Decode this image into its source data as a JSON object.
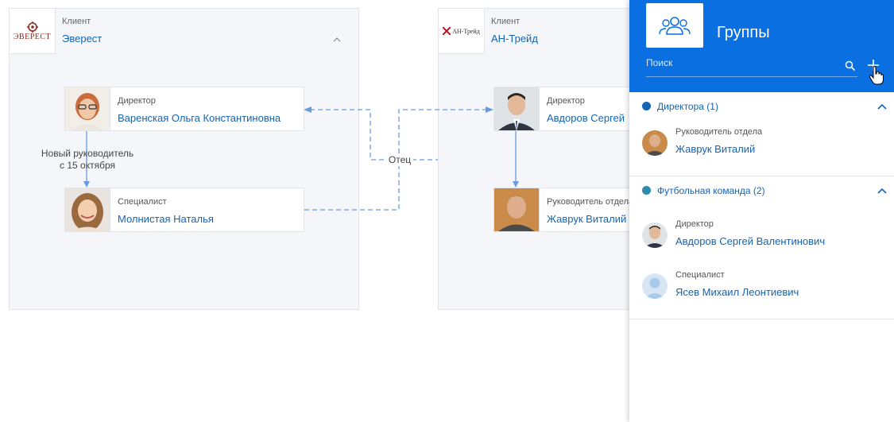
{
  "clients": {
    "everest": {
      "caption": "Клиент",
      "name": "Эверест",
      "logo_text": "ЭВЕРЕСТ",
      "logo_color": "#8a2a1e"
    },
    "an_trade": {
      "caption": "Клиент",
      "name": "АН-Трейд",
      "logo_text": "АН-Трейд",
      "logo_color": "#b3161c"
    }
  },
  "people": {
    "varenskaya": {
      "role": "Директор",
      "name": "Варенская Ольга Константиновна"
    },
    "molnistaya": {
      "role": "Специалист",
      "name": "Молнистая Наталья"
    },
    "avdorov": {
      "role": "Директор",
      "name": "Авдоров Сергей"
    },
    "zhavruk": {
      "role": "Руководитель отдела",
      "name": "Жаврук Виталий"
    }
  },
  "connector_labels": {
    "new_head_line1": "Новый руководитель",
    "new_head_line2": "с 15 октября",
    "father": "Отец"
  },
  "drawer": {
    "title": "Группы",
    "search_placeholder": "Поиск",
    "icons": {
      "header": "people-group-icon",
      "search": "search-icon",
      "add": "plus-icon",
      "cursor": "hand-cursor-icon"
    },
    "groups": [
      {
        "title": "Директора (1)",
        "dot_color": "#1464b4",
        "title_color": "#1464b4",
        "members": [
          {
            "role": "Руководитель отдела",
            "name": "Жаврук Виталий"
          }
        ]
      },
      {
        "title": "Футбольная команда (2)",
        "dot_color": "#2a8ab0",
        "title_color": "#1464b4",
        "members": [
          {
            "role": "Директор",
            "name": "Авдоров Сергей Валентинович"
          },
          {
            "role": "Специалист",
            "name": "Ясев Михаил Леонтиевич"
          }
        ]
      }
    ]
  },
  "colors": {
    "accent": "#0a6fe0",
    "link": "#1464b4",
    "connector": "#6a9be0"
  }
}
